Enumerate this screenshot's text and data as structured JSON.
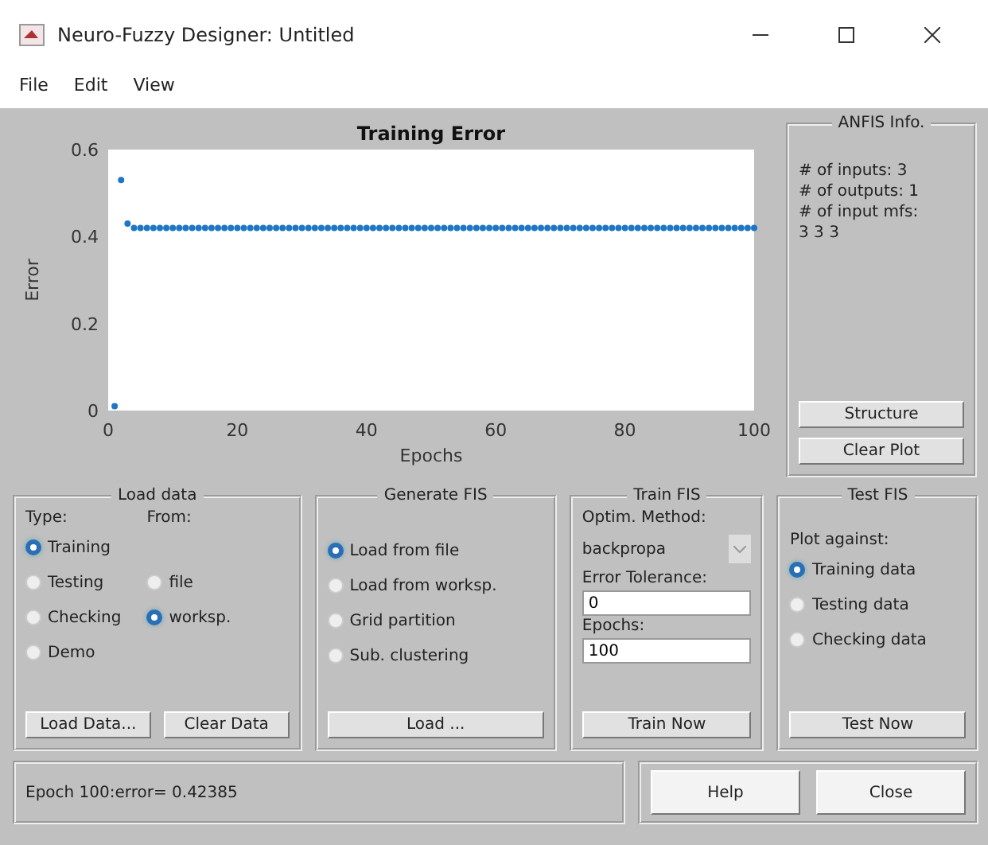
{
  "window": {
    "title": "Neuro-Fuzzy Designer: Untitled"
  },
  "menu": [
    "File",
    "Edit",
    "View"
  ],
  "plot": {
    "chart_data": {
      "type": "scatter",
      "title": "Training Error",
      "xlabel": "Epochs",
      "ylabel": "Error",
      "xlim": [
        0,
        100
      ],
      "ylim": [
        0,
        0.6
      ],
      "xticks": [
        0,
        20,
        40,
        60,
        80,
        100
      ],
      "yticks": [
        {
          "value": 0,
          "label": "0"
        },
        {
          "value": 0.2,
          "label": "0.2"
        },
        {
          "value": 0.4,
          "label": "0.4"
        },
        {
          "value": 0.6,
          "label": "0.6"
        }
      ],
      "x": [
        1,
        2,
        3,
        4,
        5,
        6,
        7,
        8,
        9,
        10,
        11,
        12,
        13,
        14,
        15,
        16,
        17,
        18,
        19,
        20,
        21,
        22,
        23,
        24,
        25,
        26,
        27,
        28,
        29,
        30,
        31,
        32,
        33,
        34,
        35,
        36,
        37,
        38,
        39,
        40,
        41,
        42,
        43,
        44,
        45,
        46,
        47,
        48,
        49,
        50,
        51,
        52,
        53,
        54,
        55,
        56,
        57,
        58,
        59,
        60,
        61,
        62,
        63,
        64,
        65,
        66,
        67,
        68,
        69,
        70,
        71,
        72,
        73,
        74,
        75,
        76,
        77,
        78,
        79,
        80,
        81,
        82,
        83,
        84,
        85,
        86,
        87,
        88,
        89,
        90,
        91,
        92,
        93,
        94,
        95,
        96,
        97,
        98,
        99,
        100
      ],
      "series": [
        {
          "color": "#1f77c4",
          "values": [
            0.01,
            0.53,
            0.43,
            0.42,
            0.42,
            0.42,
            0.42,
            0.42,
            0.42,
            0.42,
            0.42,
            0.42,
            0.42,
            0.42,
            0.42,
            0.42,
            0.42,
            0.42,
            0.42,
            0.42,
            0.42,
            0.42,
            0.42,
            0.42,
            0.42,
            0.42,
            0.42,
            0.42,
            0.42,
            0.42,
            0.42,
            0.42,
            0.42,
            0.42,
            0.42,
            0.42,
            0.42,
            0.42,
            0.42,
            0.42,
            0.42,
            0.42,
            0.42,
            0.42,
            0.42,
            0.42,
            0.42,
            0.42,
            0.42,
            0.42,
            0.42,
            0.42,
            0.42,
            0.42,
            0.42,
            0.42,
            0.42,
            0.42,
            0.42,
            0.42,
            0.42,
            0.42,
            0.42,
            0.42,
            0.42,
            0.42,
            0.42,
            0.42,
            0.42,
            0.42,
            0.42,
            0.42,
            0.42,
            0.42,
            0.42,
            0.42,
            0.42,
            0.42,
            0.42,
            0.42,
            0.42,
            0.42,
            0.42,
            0.42,
            0.42,
            0.42,
            0.42,
            0.42,
            0.42,
            0.42,
            0.42,
            0.42,
            0.42,
            0.42,
            0.42,
            0.42,
            0.42,
            0.42,
            0.42,
            0.42
          ]
        }
      ]
    }
  },
  "anfis_info": {
    "title": "ANFIS Info.",
    "lines": [
      "# of inputs: 3",
      "# of outputs: 1",
      "# of input mfs:",
      "3  3  3"
    ],
    "buttons": [
      "Structure",
      "Clear Plot"
    ]
  },
  "load_data": {
    "title": "Load data",
    "type_label": "Type:",
    "from_label": "From:",
    "type_options": [
      {
        "label": "Training",
        "selected": true
      },
      {
        "label": "Testing",
        "selected": false
      },
      {
        "label": "Checking",
        "selected": false
      },
      {
        "label": "Demo",
        "selected": false
      }
    ],
    "from_options": [
      {
        "label": "file",
        "selected": false
      },
      {
        "label": "worksp.",
        "selected": true
      }
    ],
    "buttons": [
      "Load Data...",
      "Clear Data"
    ]
  },
  "generate_fis": {
    "title": "Generate FIS",
    "options": [
      {
        "label": "Load from file",
        "selected": true
      },
      {
        "label": "Load from worksp.",
        "selected": false
      },
      {
        "label": "Grid partition",
        "selected": false
      },
      {
        "label": "Sub. clustering",
        "selected": false
      }
    ],
    "button": "Load ..."
  },
  "train_fis": {
    "title": "Train FIS",
    "method_label": "Optim. Method:",
    "method": "backpropa",
    "tolerance_label": "Error Tolerance:",
    "tolerance": "0",
    "epochs_label": "Epochs:",
    "epochs": "100",
    "button": "Train Now"
  },
  "test_fis": {
    "title": "Test FIS",
    "plot_label": "Plot against:",
    "options": [
      {
        "label": "Training data",
        "selected": true
      },
      {
        "label": "Testing data",
        "selected": false
      },
      {
        "label": "Checking data",
        "selected": false
      }
    ],
    "button": "Test Now"
  },
  "status": "Epoch 100:error= 0.42385",
  "footer_buttons": [
    "Help",
    "Close"
  ]
}
